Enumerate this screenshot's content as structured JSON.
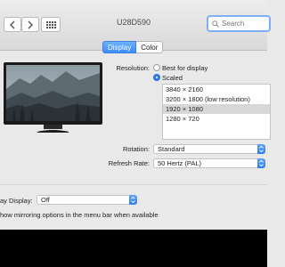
{
  "window": {
    "title": "U28D590",
    "search_placeholder": "Search"
  },
  "tabs": [
    {
      "label": "Display",
      "active": true
    },
    {
      "label": "Color",
      "active": false
    }
  ],
  "resolution": {
    "label": "Resolution:",
    "options": [
      {
        "label": "Best for display",
        "selected": false
      },
      {
        "label": "Scaled",
        "selected": true
      }
    ],
    "list": [
      "3840 × 2160",
      "3200 × 1800 (low resolution)",
      "1920 × 1080",
      "1280 × 720"
    ],
    "selected_index": 2
  },
  "rotation": {
    "label": "Rotation:",
    "value": "Standard"
  },
  "refresh_rate": {
    "label": "Refresh Rate:",
    "value": "50 Hertz (PAL)"
  },
  "airplay": {
    "label": "ay Display:",
    "value": "Off"
  },
  "mirroring": {
    "label": "how mirroring options in the menu bar when available",
    "checked": false
  },
  "colors": {
    "accent": "#2f7ff0",
    "search_focus": "#7eaef3"
  },
  "icons": [
    "back-arrow-icon",
    "forward-arrow-icon",
    "grid-icon",
    "search-icon",
    "chevron-updown-icon"
  ]
}
